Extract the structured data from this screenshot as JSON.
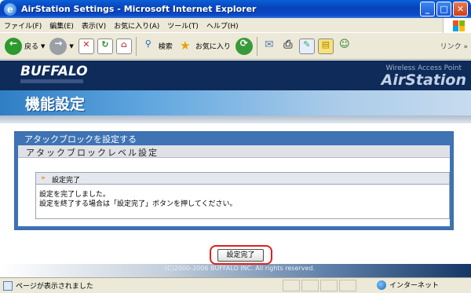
{
  "window": {
    "title": "AirStation Settings - Microsoft Internet Explorer",
    "min": "_",
    "max": "□",
    "close": "✕"
  },
  "menu": [
    "ファイル(F)",
    "編集(E)",
    "表示(V)",
    "お気に入り(A)",
    "ツール(T)",
    "ヘルプ(H)"
  ],
  "toolbar": {
    "back": "戻る",
    "search": "検索",
    "favorites": "お気に入り",
    "links": "リンク »"
  },
  "header": {
    "brand": "BUFFALO",
    "product_tag": "Wireless Access Point",
    "product": "AirStation",
    "page_title": "機能設定"
  },
  "panel": {
    "title": "アタックブロックを設定する",
    "subtitle": "アタックブロックレベル設定",
    "box_title": "設定完了",
    "lines": [
      "設定を完了しました。",
      "設定を終了する場合は「設定完了」ボタンを押してください。"
    ]
  },
  "done_button": "設定完了",
  "footer": "(C)2000-2006 BUFFALO INC. All rights reserved.",
  "status": {
    "text": "ページが表示されました",
    "zone": "インターネット"
  },
  "colors": {
    "header_dark": "#0e2b59",
    "panel_blue": "#3e73b4",
    "highlight_red": "#e02020"
  }
}
